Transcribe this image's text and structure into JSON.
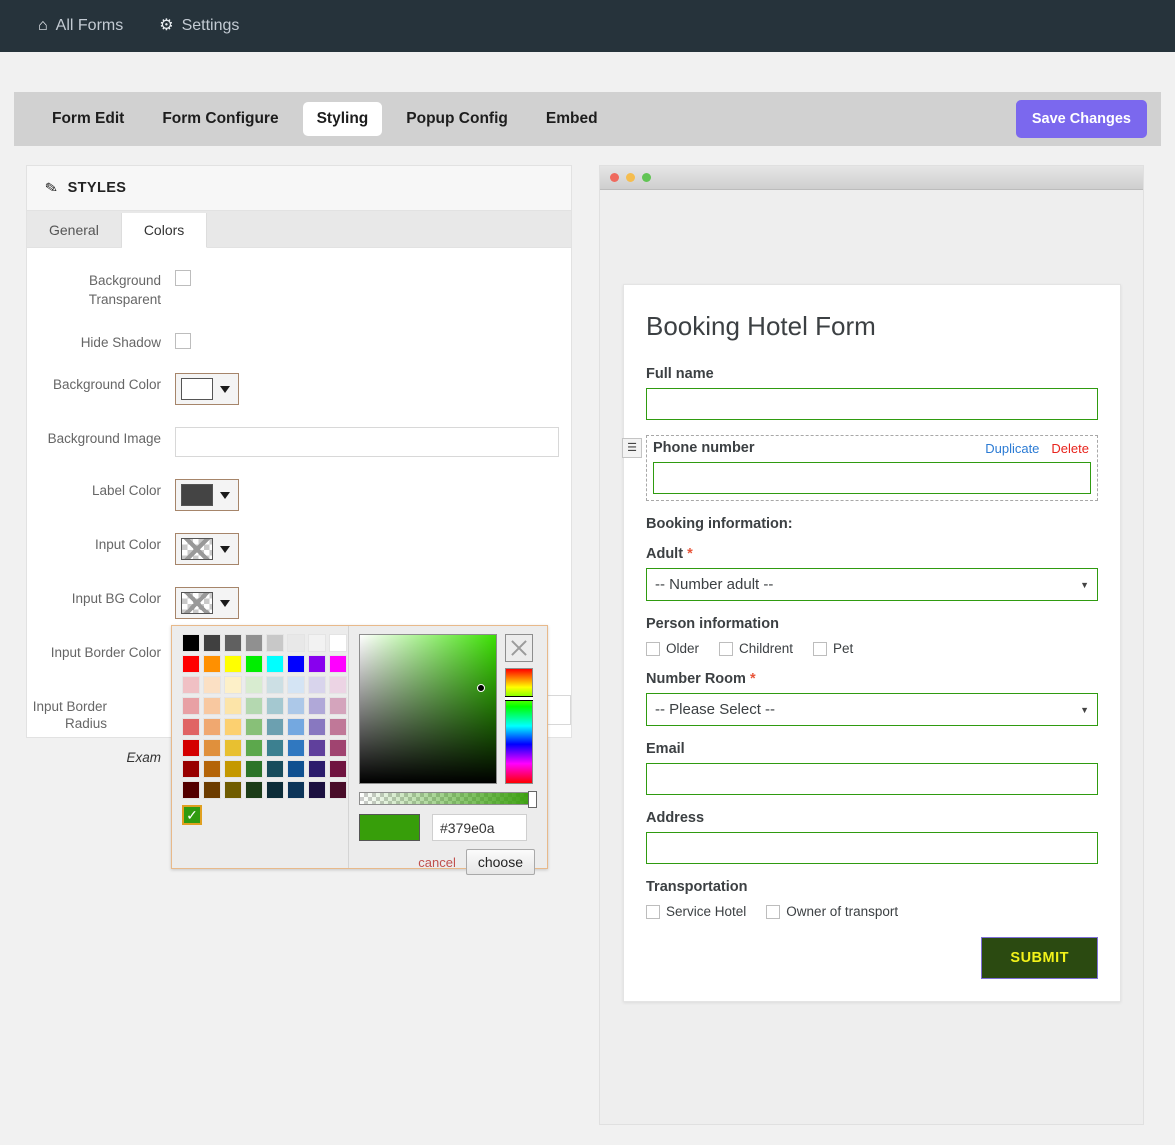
{
  "adminbar": {
    "items": [
      {
        "icon": "home-icon",
        "glyph": "⌂",
        "label": "All Forms"
      },
      {
        "icon": "gear-icon",
        "glyph": "⚙",
        "label": "Settings"
      }
    ]
  },
  "tabbar": {
    "tabs": [
      {
        "label": "Form Edit",
        "active": false
      },
      {
        "label": "Form Configure",
        "active": false
      },
      {
        "label": "Styling",
        "active": true
      },
      {
        "label": "Popup Config",
        "active": false
      },
      {
        "label": "Embed",
        "active": false
      }
    ],
    "save_label": "Save Changes",
    "save_color": "#7b68ee"
  },
  "styles_panel": {
    "header_title": "STYLES",
    "header_icon": "brush-icon",
    "subtabs": [
      {
        "label": "General",
        "active": false
      },
      {
        "label": "Colors",
        "active": true
      }
    ],
    "rows": {
      "background_transparent": {
        "label": "Background Transparent",
        "checked": false
      },
      "hide_shadow": {
        "label": "Hide Shadow",
        "checked": false
      },
      "background_color": {
        "label": "Background Color",
        "value": "#ffffff",
        "type": "color"
      },
      "background_image": {
        "label": "Background Image",
        "value": "",
        "placeholder": ""
      },
      "label_color": {
        "label": "Label Color",
        "value": "#444444",
        "type": "color"
      },
      "input_color": {
        "label": "Input Color",
        "value": "none",
        "type": "color"
      },
      "input_bg_color": {
        "label": "Input BG Color",
        "value": "none",
        "type": "color"
      },
      "input_border_color": {
        "label": "Input Border Color",
        "value": "#2f9b10",
        "type": "color"
      },
      "input_border_radius": {
        "label": "Input Border Radius",
        "value": ""
      },
      "example_note": "Exam"
    }
  },
  "color_picker": {
    "hex_value": "#379e0a",
    "preview_color": "#379e0a",
    "cancel_label": "cancel",
    "choose_label": "choose",
    "clear_icon": "clear-color-x-icon",
    "palette": [
      [
        "#000000",
        "#404040",
        "#606060",
        "#909090",
        "#c8c8c8",
        "#e8e8e8",
        "#f2f2f2",
        "#ffffff"
      ],
      [
        "#ff0000",
        "#ff9000",
        "#ffff00",
        "#00ee00",
        "#00ffff",
        "#0000ff",
        "#8800ee",
        "#ff00ff"
      ],
      [
        "#f0c0c4",
        "#fbe0c4",
        "#fdf0c8",
        "#d8ecd0",
        "#ccdfe4",
        "#d4e4f4",
        "#d8d4ec",
        "#ecd4e4"
      ],
      [
        "#e8a0a4",
        "#f8c8a0",
        "#fce4a8",
        "#b4d8b0",
        "#a4c8d0",
        "#acc8e8",
        "#b0a8d8",
        "#d4a4bc"
      ],
      [
        "#e06464",
        "#f0a870",
        "#fcd070",
        "#88c078",
        "#6ca0b0",
        "#74a8e0",
        "#8878c0",
        "#c07898"
      ],
      [
        "#d40000",
        "#e0903c",
        "#e8c030",
        "#5ca84c",
        "#3c8090",
        "#3078c0",
        "#60409c",
        "#a04470"
      ],
      [
        "#980000",
        "#b46408",
        "#c49800",
        "#2c7428",
        "#184c5c",
        "#105090",
        "#2c1c6c",
        "#701440"
      ],
      [
        "#540000",
        "#6c3c00",
        "#705c00",
        "#1c3c18",
        "#0c2c38",
        "#0c3458",
        "#1c1040",
        "#480c28"
      ]
    ]
  },
  "preview": {
    "chrome_dots": [
      "#ef6a5e",
      "#f5bd4f",
      "#61c454"
    ],
    "form": {
      "title": "Booking Hotel Form",
      "fields": [
        {
          "label": "Full name",
          "type": "text",
          "value": "",
          "required": false
        },
        {
          "label": "Phone number",
          "type": "text",
          "value": "",
          "required": false,
          "selected": true,
          "duplicate_label": "Duplicate",
          "delete_label": "Delete",
          "handle_icon": "drag-handle-icon"
        },
        {
          "label": "Booking information:",
          "type": "heading"
        },
        {
          "label": "Adult",
          "type": "select",
          "required": true,
          "value": "-- Number adult --"
        },
        {
          "label": "Person information",
          "type": "checkbox-group",
          "options": [
            "Older",
            "Childrent",
            "Pet"
          ]
        },
        {
          "label": "Number Room",
          "type": "select",
          "required": true,
          "value": "-- Please Select --"
        },
        {
          "label": "Email",
          "type": "text",
          "value": "",
          "required": false
        },
        {
          "label": "Address",
          "type": "text",
          "value": "",
          "required": false
        },
        {
          "label": "Transportation",
          "type": "checkbox-group",
          "options": [
            "Service Hotel",
            "Owner of transport"
          ]
        }
      ],
      "submit_label": "SUBMIT",
      "submit_bg": "#2b4a11",
      "submit_fg": "#f2f21a",
      "submit_border": "#7e6fd8",
      "input_border_color": "#2f9b10"
    }
  }
}
